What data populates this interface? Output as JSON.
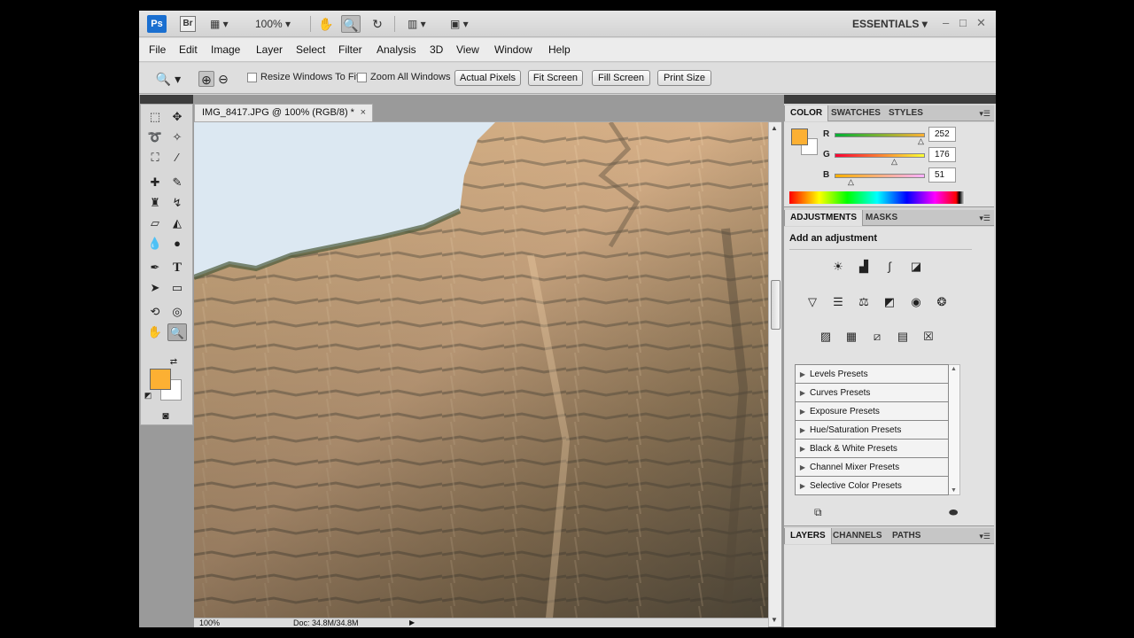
{
  "appbar": {
    "logo": "Ps",
    "bridge": "Br",
    "zoom_value": "100%",
    "workspace": "ESSENTIALS",
    "win_min": "–",
    "win_max": "□",
    "win_close": "✕"
  },
  "menu": [
    "File",
    "Edit",
    "Image",
    "Layer",
    "Select",
    "Filter",
    "Analysis",
    "3D",
    "View",
    "Window",
    "Help"
  ],
  "options": {
    "resize_windows": "Resize Windows To Fit",
    "zoom_all": "Zoom All Windows",
    "actual_pixels": "Actual Pixels",
    "fit_screen": "Fit Screen",
    "fill_screen": "Fill Screen",
    "print_size": "Print Size"
  },
  "document": {
    "tab_title": "IMG_8417.JPG @ 100% (RGB/8) *",
    "tab_close": "×",
    "zoom": "100%",
    "doc_size": "Doc: 34.8M/34.8M"
  },
  "colors": {
    "foreground": "#fcb033",
    "background": "#ffffff",
    "sky": "#dce8f2"
  },
  "color_panel": {
    "tabs": [
      "COLOR",
      "SWATCHES",
      "STYLES"
    ],
    "r_label": "R",
    "r_value": "252",
    "r_fraction": 0.988,
    "g_label": "G",
    "g_value": "176",
    "g_fraction": 0.69,
    "b_label": "B",
    "b_value": "51",
    "b_fraction": 0.2
  },
  "adjustments_panel": {
    "tabs": [
      "ADJUSTMENTS",
      "MASKS"
    ],
    "title": "Add an adjustment",
    "icons_row1": [
      "brightness-contrast-icon",
      "levels-icon",
      "curves-icon",
      "exposure-icon"
    ],
    "icons_row2": [
      "vibrance-icon",
      "hue-saturation-icon",
      "color-balance-icon",
      "black-white-icon",
      "photo-filter-icon",
      "channel-mixer-icon"
    ],
    "icons_row3": [
      "invert-icon",
      "posterize-icon",
      "threshold-icon",
      "gradient-map-icon",
      "selective-color-icon"
    ],
    "presets": [
      "Levels Presets",
      "Curves Presets",
      "Exposure Presets",
      "Hue/Saturation Presets",
      "Black & White Presets",
      "Channel Mixer Presets",
      "Selective Color Presets"
    ]
  },
  "layers_panel": {
    "tabs": [
      "LAYERS",
      "CHANNELS",
      "PATHS"
    ]
  }
}
